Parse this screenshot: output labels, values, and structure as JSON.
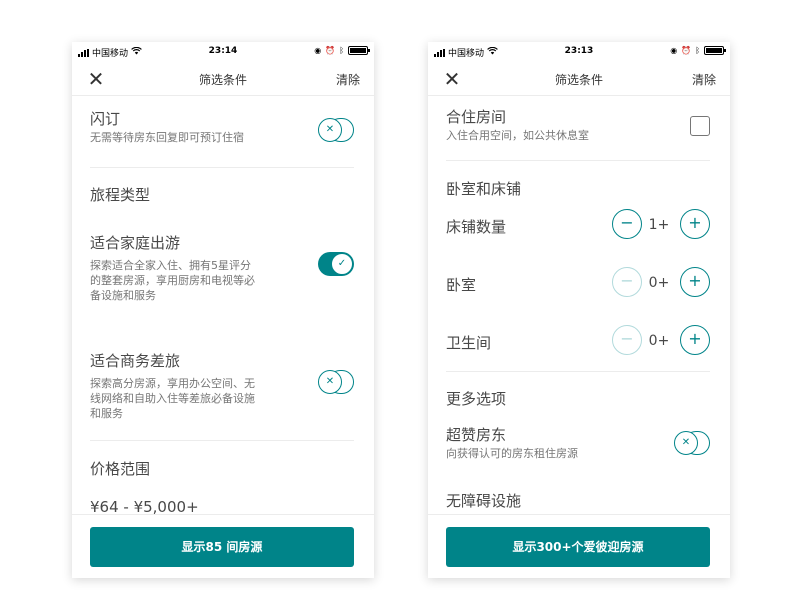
{
  "status_bar_left": {
    "carrier": "中国移动",
    "time": "23:14"
  },
  "status_bar_right": {
    "carrier": "中国移动",
    "time": "23:13"
  },
  "nav": {
    "close_glyph": "✕",
    "title": "筛选条件",
    "clear_label": "清除"
  },
  "left_screen": {
    "instant_book": {
      "title": "闪订",
      "subtitle": "无需等待房东回复即可预订住宿",
      "enabled": false
    },
    "trip_type_section": "旅程类型",
    "family": {
      "title": "适合家庭出游",
      "subtitle_lines": [
        "探索适合全家入住、拥有5星评分",
        "的整套房源，享用厨房和电视等必",
        "备设施和服务"
      ],
      "enabled": true
    },
    "business": {
      "title": "适合商务差旅",
      "subtitle_lines": [
        "探索高分房源，享用办公空间、无",
        "线网络和自助入住等差旅必备设施",
        "和服务"
      ],
      "enabled": false
    },
    "price_section": "价格范围",
    "price_range": "¥64 - ¥5,000+",
    "cta_label": "显示85 间房源"
  },
  "right_screen": {
    "shared_room": {
      "title": "合住房间",
      "subtitle": "入住合用空间，如公共休息室",
      "checked": false
    },
    "rooms_section": "卧室和床铺",
    "steppers": [
      {
        "label": "床铺数量",
        "value": "1+",
        "minus_enabled": true
      },
      {
        "label": "卧室",
        "value": "0+",
        "minus_enabled": false
      },
      {
        "label": "卫生间",
        "value": "0+",
        "minus_enabled": false
      }
    ],
    "more_section": "更多选项",
    "superhost": {
      "title": "超赞房东",
      "subtitle": "向获得认可的房东租住房源",
      "enabled": false
    },
    "accessibility_section": "无障碍设施",
    "cta_label": "显示300+个爱彼迎房源"
  },
  "glyphs": {
    "minus": "−",
    "plus": "+",
    "toggle_off": "✕",
    "toggle_on": "✓"
  },
  "colors": {
    "accent": "#008489",
    "accent_disabled": "#b2dadc",
    "text": "#484848",
    "subtext": "#767676"
  }
}
